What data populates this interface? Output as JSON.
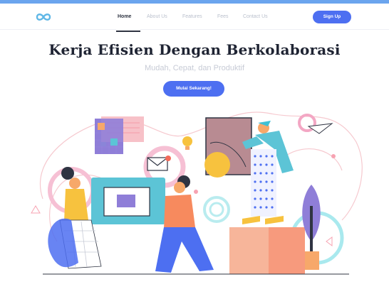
{
  "nav": {
    "links": [
      "Home",
      "About Us",
      "Features",
      "Fees",
      "Contact Us"
    ],
    "signup_label": "Sign Up"
  },
  "hero": {
    "title": "Kerja Efisien Dengan Berkolaborasi",
    "subtitle": "Mudah, Cepat, dan Produktif",
    "cta_label": "Mulai Sekarang!"
  },
  "colors": {
    "accent": "#4d6ff1",
    "topbar": "#6ba5ee",
    "title": "#1f2433",
    "nav_inactive": "#b9bfcc"
  },
  "icons": [
    "infinity-logo-icon"
  ]
}
